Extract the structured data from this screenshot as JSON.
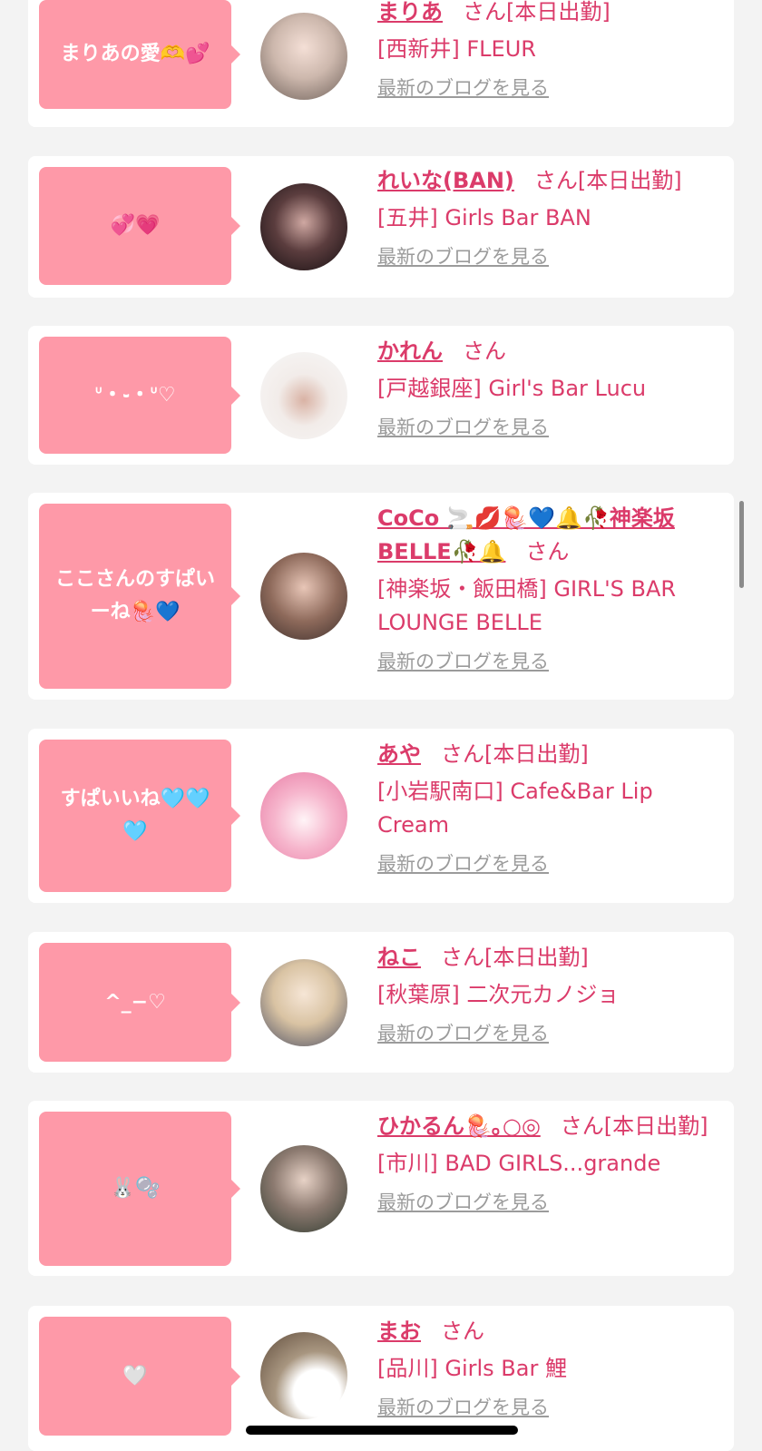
{
  "theme": {
    "bubble_color": "#fe99a8",
    "accent": "#db3b6a",
    "link_gray": "#9b9b9b"
  },
  "blog_link_label": "最新のブログを見る",
  "cards": [
    {
      "bubble": "まりあの愛🫶💕",
      "name": "まりあ",
      "suffix": "さん[本日出勤]",
      "shop": "[西新井] FLEUR"
    },
    {
      "bubble": "💞💗",
      "name": "れいな(BAN)",
      "suffix": "さん[本日出勤]",
      "shop": "[五井] Girls Bar BAN"
    },
    {
      "bubble": "ᐡ・֊・ᐡ♡",
      "name": "かれん",
      "suffix": "さん",
      "shop": "[戸越銀座] Girl's Bar Lucu"
    },
    {
      "bubble": "ここさんのすぱいーね🪼💙",
      "name": "CoCo 🚬💋🪼💙🔔🥀神楽坂BELLE🥀🔔",
      "suffix": "さん",
      "shop": "[神楽坂・飯田橋] GIRL'S BAR LOUNGE BELLE"
    },
    {
      "bubble": "すぱいいね🩵🩵🩵",
      "name": "あや",
      "suffix": "さん[本日出勤]",
      "shop": "[小岩駅南口] Cafe&Bar Lip Cream"
    },
    {
      "bubble": "^_−♡",
      "name": "ねこ",
      "suffix": "さん[本日出勤]",
      "shop": "[秋葉原] 二次元カノジョ"
    },
    {
      "bubble": "🐰🫧",
      "name": "ひかるん🪼｡○◎",
      "suffix": "さん[本日出勤]",
      "shop": "[市川] BAD GIRLS...grande"
    },
    {
      "bubble": "🤍",
      "name": "まお",
      "suffix": "さん",
      "shop": "[品川] Girls Bar 鯉"
    }
  ]
}
